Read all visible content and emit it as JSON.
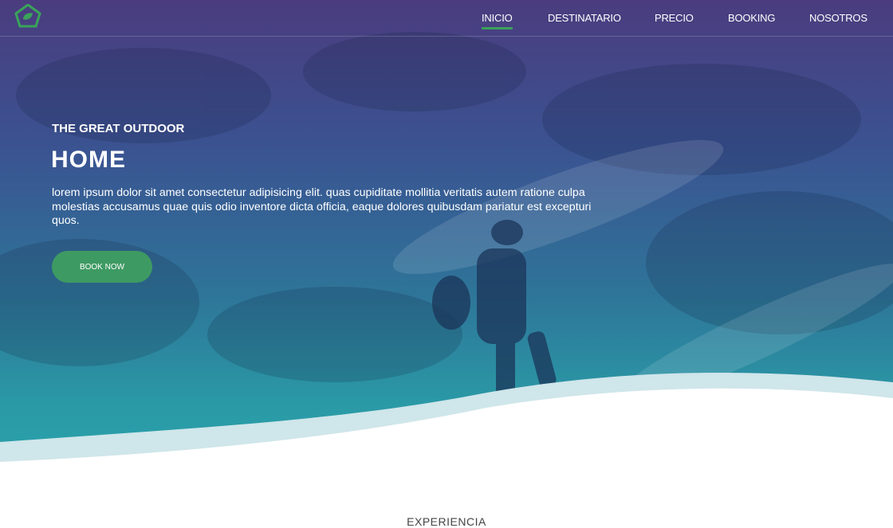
{
  "nav": {
    "items": [
      {
        "label": "INICIO",
        "active": true
      },
      {
        "label": "DESTINATARIO",
        "active": false
      },
      {
        "label": "PRECIO",
        "active": false
      },
      {
        "label": "BOOKING",
        "active": false
      },
      {
        "label": "NOSOTROS",
        "active": false
      }
    ],
    "logo_icon": "leaf-logo-icon"
  },
  "hero": {
    "eyebrow": "THE GREAT OUTDOOR",
    "title": "HOME",
    "description": "lorem ipsum dolor sit amet consectetur adipisicing elit. quas cupiditate mollitia veritatis autem ratione culpa molestias accusamus quae quis odio inventore dicta officia, eaque dolores quibusdam pariatur est excepturi quos.",
    "button_label": "BOOK NOW"
  },
  "next_section": {
    "heading": "EXPERIENCIA"
  },
  "colors": {
    "accent": "#3e9a63",
    "gradient_top": "#4a3c7e",
    "gradient_bottom": "#2aa3ab"
  }
}
